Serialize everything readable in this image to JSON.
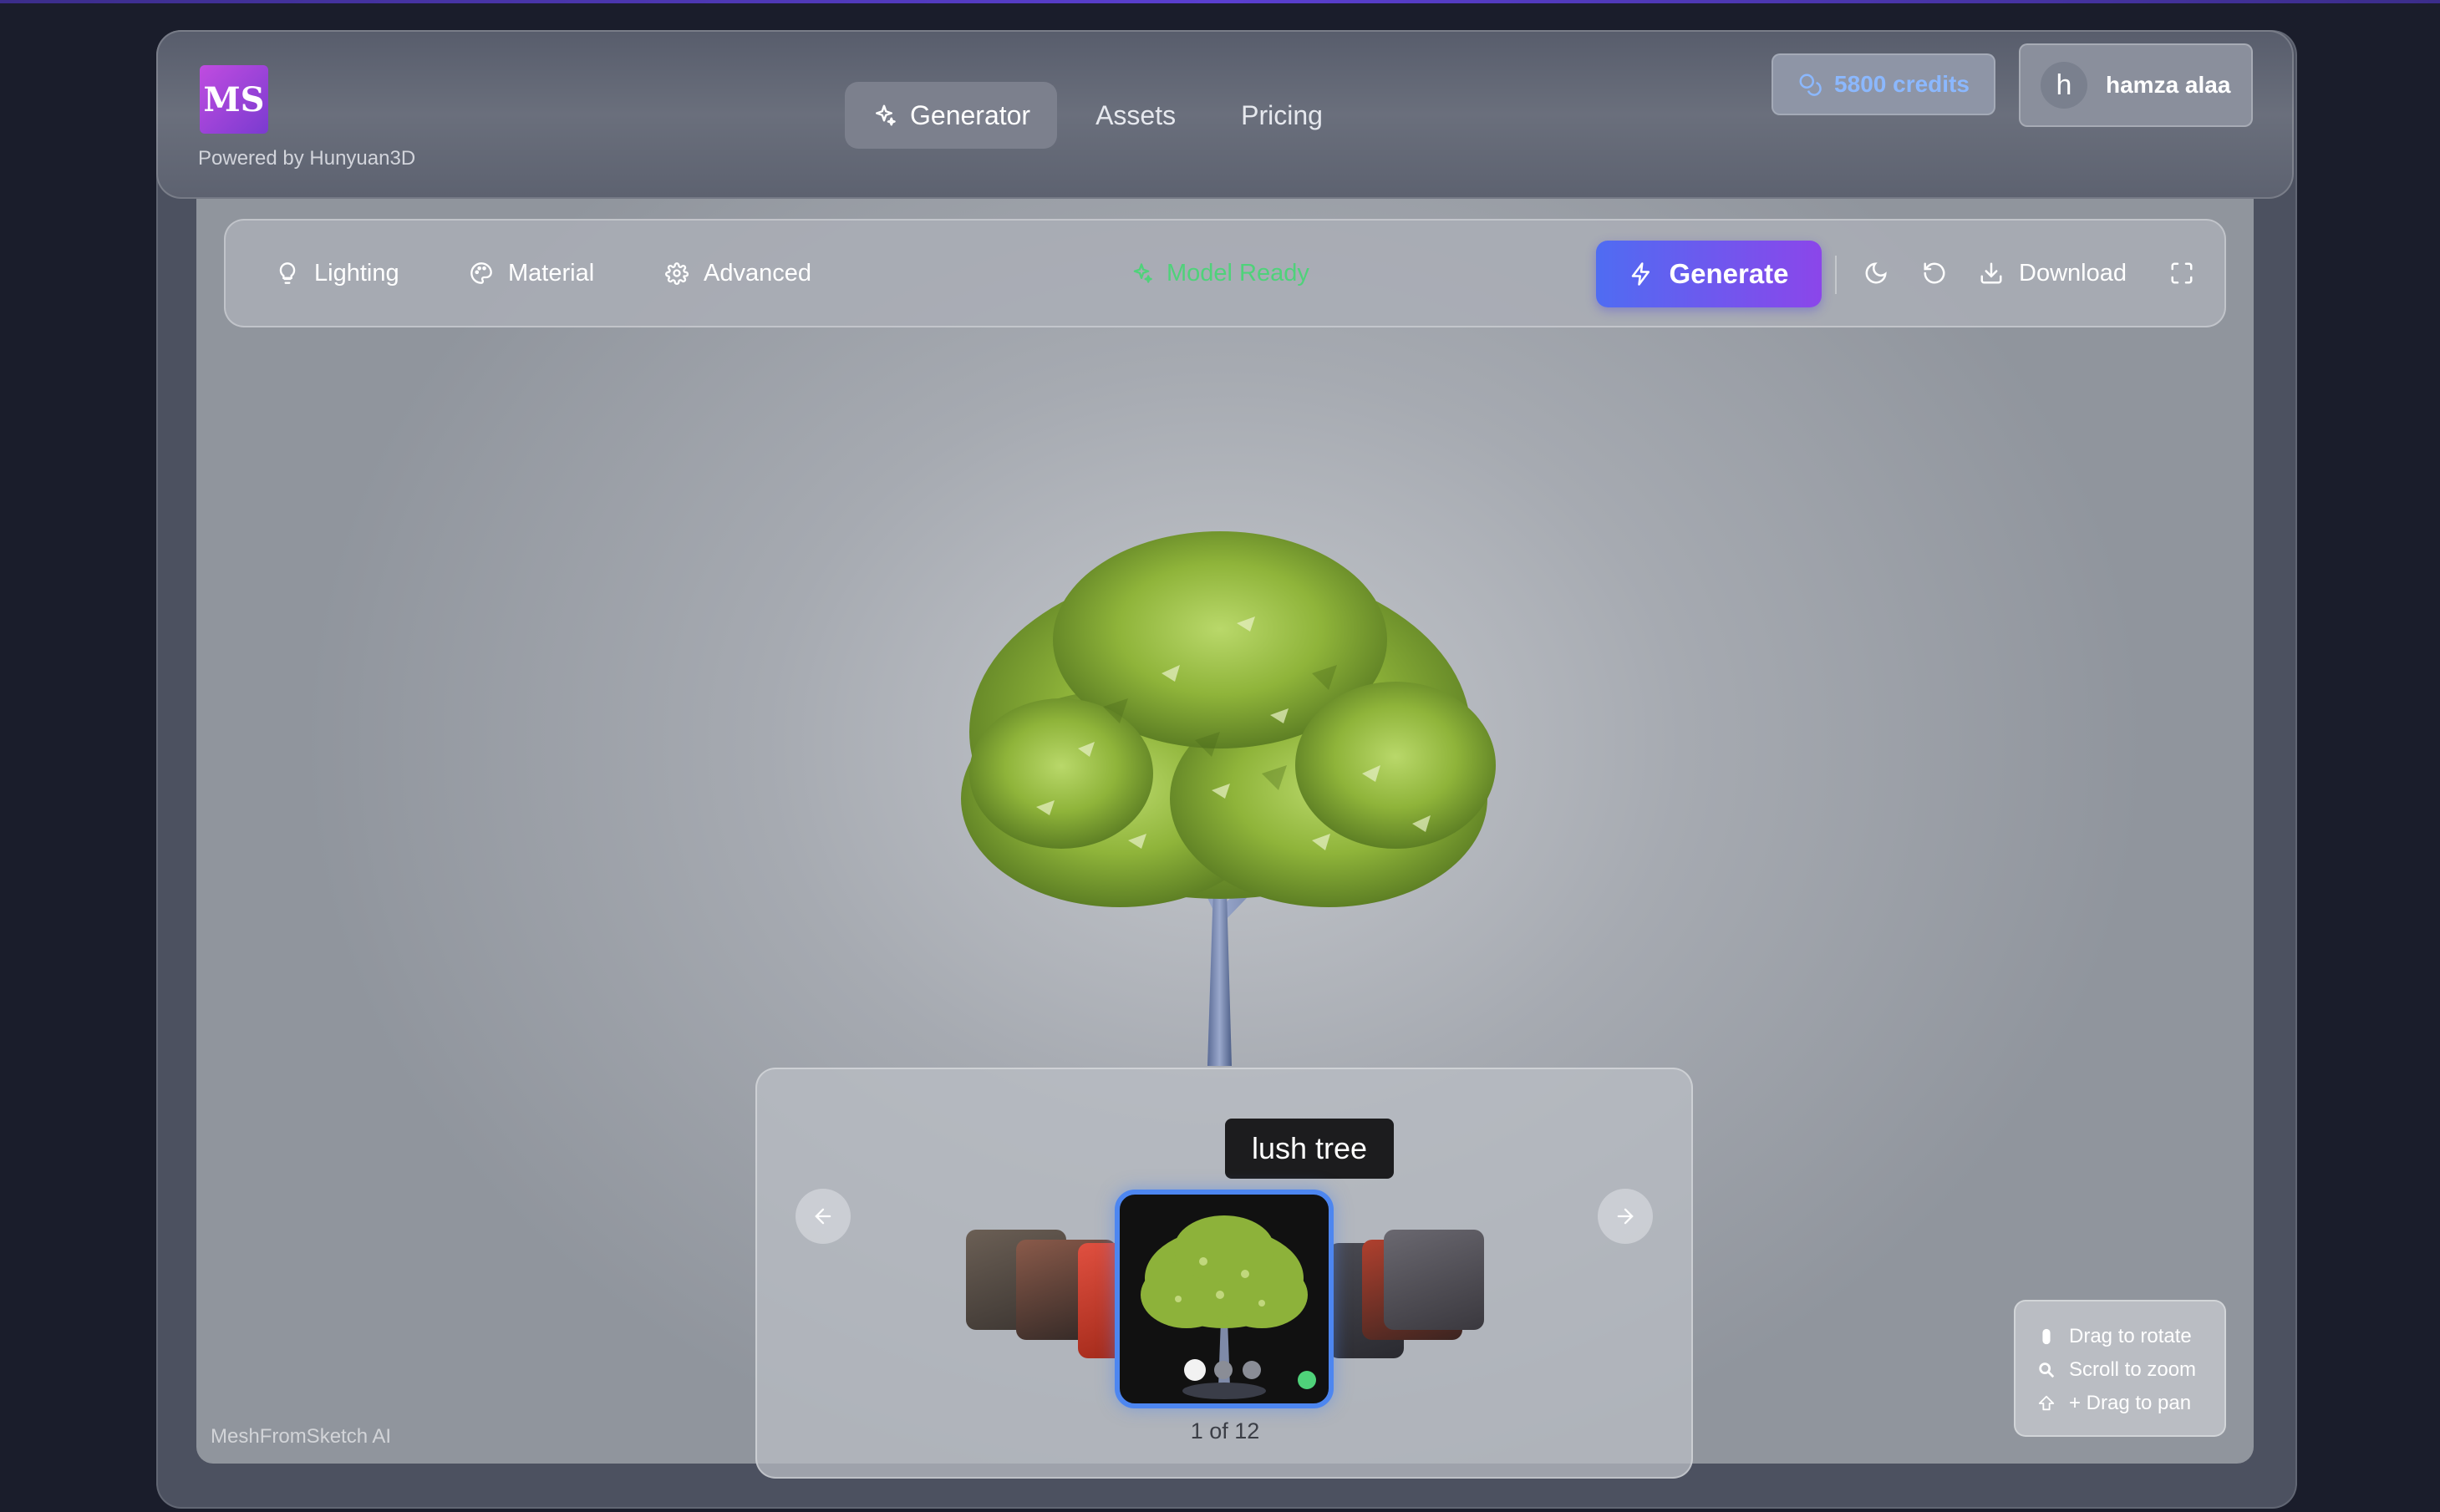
{
  "app": {
    "logo_text": "MS",
    "powered_by": "Powered by Hunyuan3D"
  },
  "nav": {
    "items": [
      {
        "label": "Generator",
        "icon": "sparkles-icon",
        "active": true
      },
      {
        "label": "Assets",
        "active": false
      },
      {
        "label": "Pricing",
        "active": false
      }
    ]
  },
  "account": {
    "credits": "5800 credits",
    "avatar_initial": "h",
    "username": "hamza alaa"
  },
  "toolbar": {
    "lighting": "Lighting",
    "material": "Material",
    "advanced": "Advanced",
    "status": "Model Ready",
    "generate": "Generate",
    "download": "Download"
  },
  "viewer": {
    "selected_model": "lush tree",
    "counter": "1 of 12",
    "watermark": "MeshFromSketch AI",
    "help": [
      "Drag to rotate",
      "Scroll to zoom",
      "+ Drag to pan"
    ]
  },
  "colors": {
    "accent_start": "#4f6cf2",
    "accent_end": "#8b46ea",
    "status_green": "#4fd27a",
    "credits_blue": "#8bb8ff",
    "selected_border": "#4d86f0"
  }
}
